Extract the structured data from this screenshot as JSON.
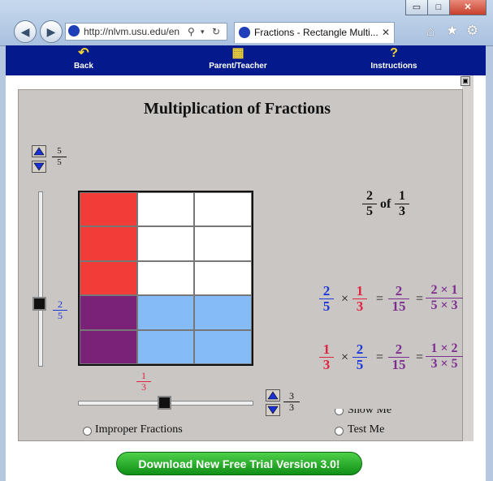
{
  "window": {
    "url": "http://nlvm.usu.edu/en",
    "tab_title": "Fractions - Rectangle Multi...",
    "min_label": "▭",
    "max_label": "□",
    "close_label": "✕"
  },
  "app_nav": [
    {
      "label": "Back"
    },
    {
      "label": "Parent/Teacher"
    },
    {
      "label": "Instructions"
    }
  ],
  "title": "Multiplication of Fractions",
  "rows_fraction": {
    "num": "5",
    "den": "5"
  },
  "cols_fraction": {
    "num": "3",
    "den": "3"
  },
  "vertical_slider_value": {
    "num": "2",
    "den": "5"
  },
  "horizontal_slider_value": {
    "num": "1",
    "den": "3"
  },
  "of_expression": {
    "a_num": "2",
    "a_den": "5",
    "word": "of",
    "b_num": "1",
    "b_den": "3"
  },
  "equation1": {
    "a_num": "2",
    "a_den": "5",
    "b_num": "1",
    "b_den": "3",
    "r_num": "2",
    "r_den": "15",
    "e_num": "2 × 1",
    "e_den": "5 × 3",
    "times": "×",
    "eq": "="
  },
  "equation2": {
    "a_num": "1",
    "a_den": "3",
    "b_num": "2",
    "b_den": "5",
    "r_num": "2",
    "r_den": "15",
    "e_num": "1 × 2",
    "e_den": "3 × 5",
    "times": "×",
    "eq": "="
  },
  "options": {
    "improper_fractions": "Improper Fractions",
    "show_me": "Show Me",
    "test_me": "Test Me"
  },
  "download_button": "Download New Free Trial Version 3.0!",
  "grid_fill": {
    "rows": 5,
    "cols": 3,
    "vertical_fraction": 0.4,
    "horizontal_fraction": 0.3333
  },
  "colors": {
    "red": "#f23c37",
    "blue": "#85bbf7",
    "purple": "#7a2277",
    "white": "#ffffff",
    "nav_bg": "#041a8c",
    "blue_text": "#1d37d8",
    "red_text": "#e2233f",
    "purple_text": "#7d2f8f"
  }
}
